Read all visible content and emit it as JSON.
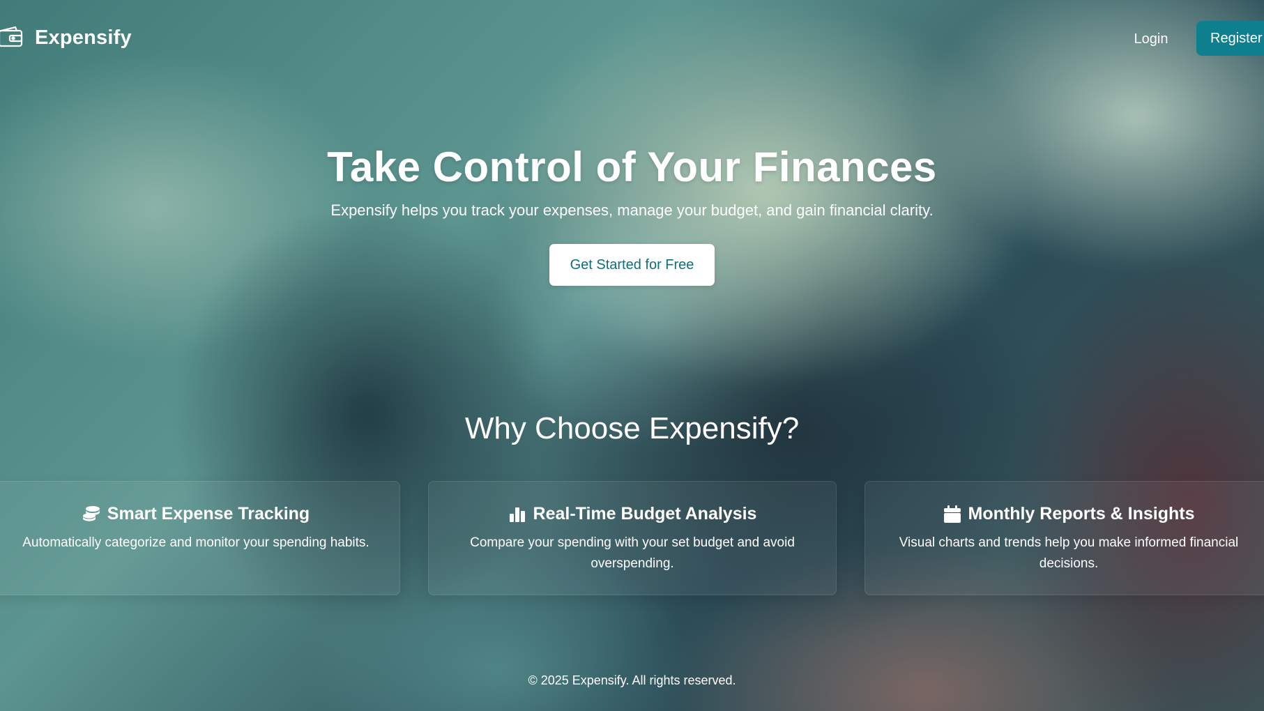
{
  "header": {
    "brand_name": "Expensify",
    "brand_icon": "wallet-icon",
    "login_label": "Login",
    "register_label": "Register"
  },
  "hero": {
    "title": "Take Control of Your Finances",
    "subtitle": "Expensify helps you track your expenses, manage your budget, and gain financial clarity.",
    "cta_label": "Get Started for Free"
  },
  "features": {
    "heading": "Why Choose Expensify?",
    "items": [
      {
        "icon": "coins-icon",
        "title": "Smart Expense Tracking",
        "description": "Automatically categorize and monitor your spending habits."
      },
      {
        "icon": "bar-chart-icon",
        "title": "Real-Time Budget Analysis",
        "description": "Compare your spending with your set budget and avoid overspending."
      },
      {
        "icon": "calendar-icon",
        "title": "Monthly Reports & Insights",
        "description": "Visual charts and trends help you make informed financial decisions."
      }
    ]
  },
  "footer": {
    "copyright": "© 2025 Expensify. All rights reserved."
  },
  "colors": {
    "accent": "#0e7f8f",
    "cta_text": "#0d6f7d",
    "text": "#ffffff"
  }
}
